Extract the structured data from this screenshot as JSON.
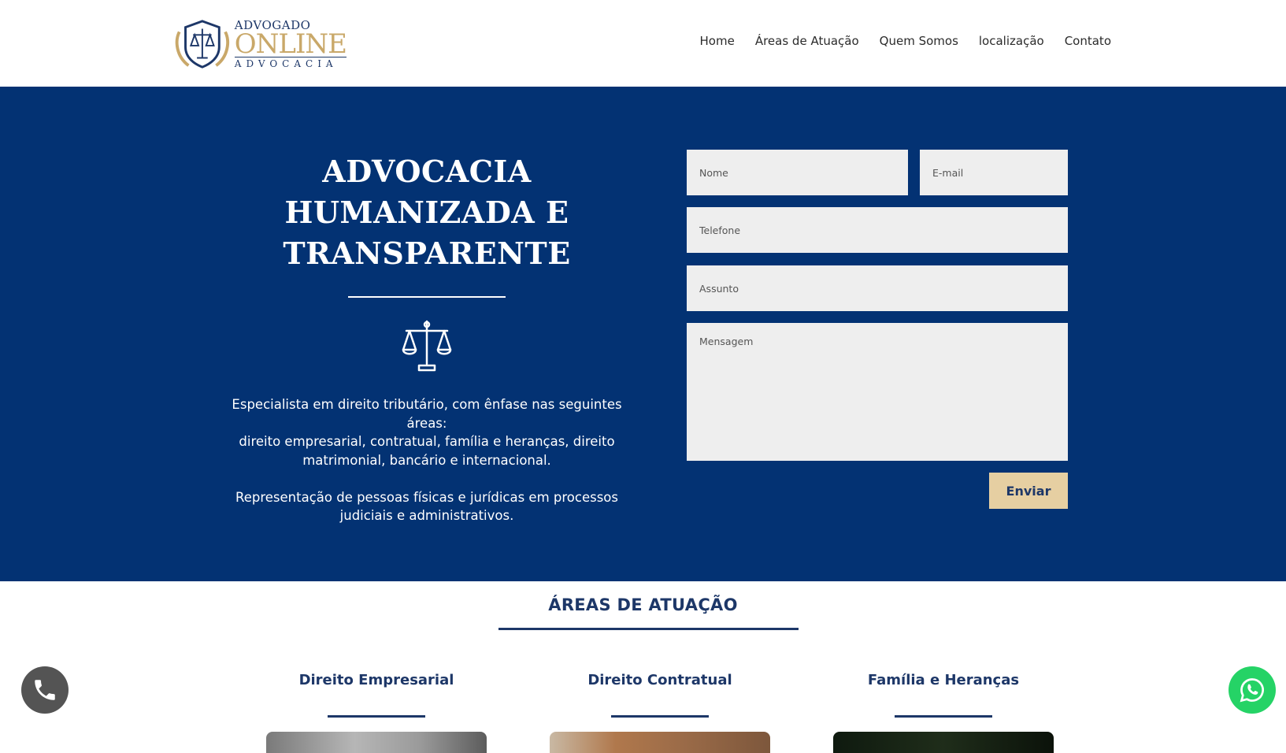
{
  "logo": {
    "line1": "ADVOGADO",
    "line2": "ONLINE",
    "line3": "ADVOCACIA",
    "icon": "scales-shield-icon"
  },
  "nav": {
    "items": [
      "Home",
      "Áreas de Atuação",
      "Quem Somos",
      "localização",
      "Contato"
    ]
  },
  "hero": {
    "title": "ADVOCACIA HUMANIZADA E TRANSPARENTE",
    "icon": "scales-of-justice-icon",
    "description": "Especialista em direito tributário, com ênfase nas seguintes áreas:\ndireito empresarial, contratual, família e heranças, direito matrimonial, bancário e internacional.\n\nRepresentação de pessoas físicas e jurídicas em processos judiciais e administrativos."
  },
  "form": {
    "nome_placeholder": "Nome",
    "email_placeholder": "E-mail",
    "telefone_placeholder": "Telefone",
    "assunto_placeholder": "Assunto",
    "mensagem_placeholder": "Mensagem",
    "submit_label": "Enviar"
  },
  "areas": {
    "title": "ÁREAS DE ATUAÇÃO",
    "items": [
      "Direito Empresarial",
      "Direito Contratual",
      "Família e Heranças"
    ]
  },
  "floating": {
    "phone_icon": "phone-icon",
    "whatsapp_icon": "whatsapp-icon"
  },
  "colors": {
    "primary": "#033273",
    "gold": "#e6cfa2",
    "whatsapp": "#25d366"
  }
}
